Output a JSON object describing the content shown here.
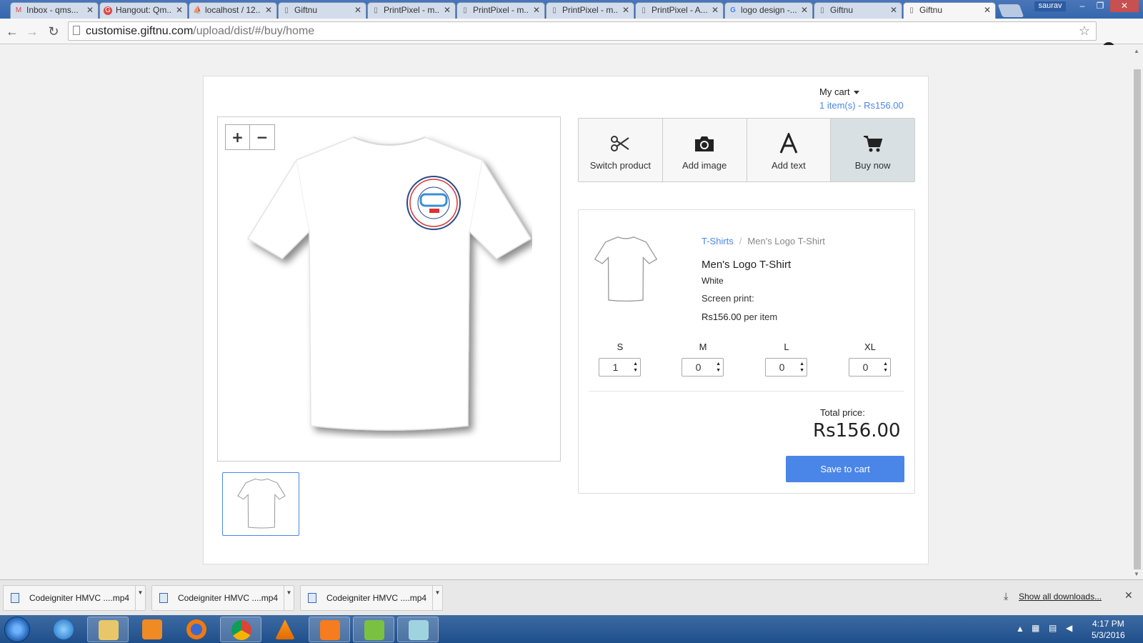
{
  "browser": {
    "tabs": [
      {
        "title": "Inbox - qms...",
        "icon": "gmail-icon"
      },
      {
        "title": "Hangout: Qm...",
        "icon": "hangouts-icon"
      },
      {
        "title": "localhost / 12...",
        "icon": "phpmyadmin-icon"
      },
      {
        "title": "Giftnu",
        "icon": "page-icon"
      },
      {
        "title": "PrintPixel - m...",
        "icon": "page-icon"
      },
      {
        "title": "PrintPixel - m...",
        "icon": "page-icon"
      },
      {
        "title": "PrintPixel - m...",
        "icon": "page-icon"
      },
      {
        "title": "PrintPixel - A...",
        "icon": "page-icon"
      },
      {
        "title": "logo design -...",
        "icon": "google-icon"
      },
      {
        "title": "Giftnu",
        "icon": "page-icon"
      },
      {
        "title": "Giftnu",
        "icon": "page-icon",
        "active": true
      }
    ],
    "user": "saurav",
    "url_host": "customise.giftnu.com",
    "url_path": "/upload/dist/#/buy/home"
  },
  "cart": {
    "label": "My cart",
    "summary": "1 item(s) - Rs156.00"
  },
  "zoom": {
    "in": "+",
    "out": "−"
  },
  "tools": [
    {
      "label": "Switch product",
      "icon": "scissors-icon"
    },
    {
      "label": "Add image",
      "icon": "camera-icon"
    },
    {
      "label": "Add text",
      "icon": "font-icon"
    },
    {
      "label": "Buy now",
      "icon": "cart-icon",
      "active": true
    }
  ],
  "product": {
    "breadcrumb_category": "T-Shirts",
    "breadcrumb_separator": "/",
    "breadcrumb_current": "Men's Logo T-Shirt",
    "name": "Men's Logo T-Shirt",
    "color": "White",
    "print": "Screen print:",
    "price": "Rs156.00",
    "price_unit": "per item"
  },
  "sizes": [
    {
      "label": "S",
      "qty": "1"
    },
    {
      "label": "M",
      "qty": "0"
    },
    {
      "label": "L",
      "qty": "0"
    },
    {
      "label": "XL",
      "qty": "0"
    }
  ],
  "total": {
    "label": "Total price:",
    "value": "Rs156.00"
  },
  "save_button": "Save to cart",
  "downloads": {
    "items": [
      "Codeigniter HMVC ....mp4",
      "Codeigniter HMVC ....mp4",
      "Codeigniter HMVC ....mp4"
    ],
    "show_all": "Show all downloads..."
  },
  "taskbar": {
    "time": "4:17 PM",
    "date": "5/3/2016"
  },
  "colors": {
    "accent": "#4a86e8",
    "tool_active_bg": "#d9e0e4"
  }
}
